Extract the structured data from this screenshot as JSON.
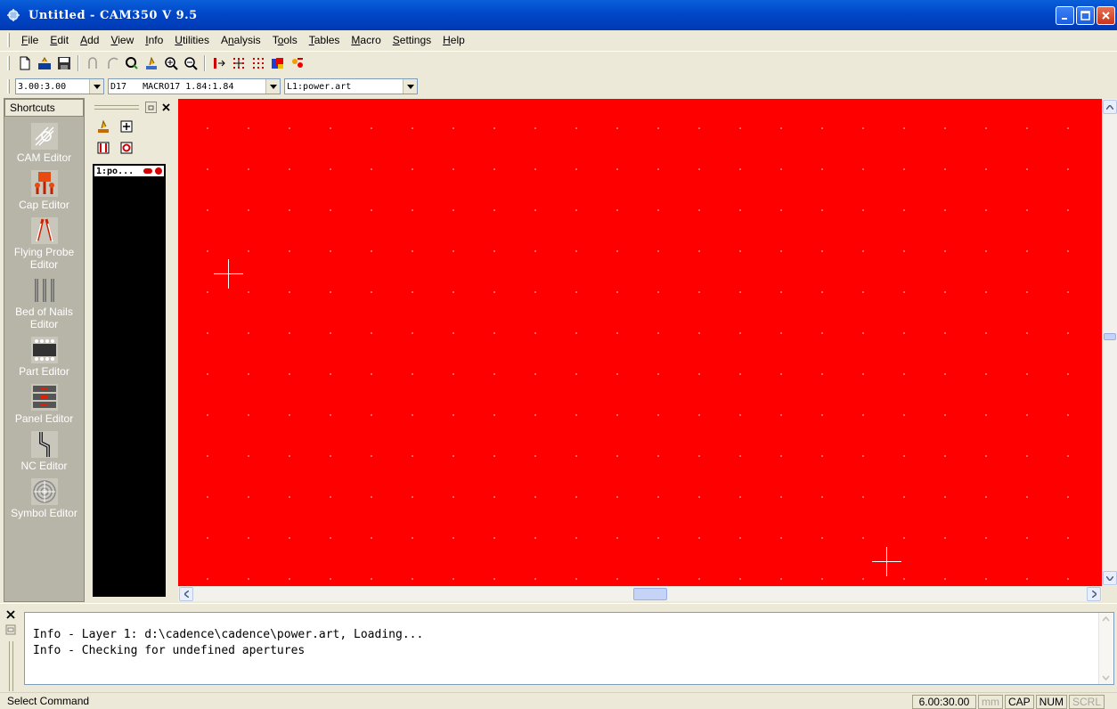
{
  "window": {
    "title": "Untitled - CAM350 V 9.5",
    "controls": {
      "minimize": "minimize",
      "maximize": "maximize",
      "close": "close"
    }
  },
  "menu": {
    "items": [
      {
        "label": "File",
        "accel": "F"
      },
      {
        "label": "Edit",
        "accel": "E"
      },
      {
        "label": "Add",
        "accel": "A"
      },
      {
        "label": "View",
        "accel": "V"
      },
      {
        "label": "Info",
        "accel": "I"
      },
      {
        "label": "Utilities",
        "accel": "U"
      },
      {
        "label": "Analysis",
        "accel": "n"
      },
      {
        "label": "Tools",
        "accel": "o"
      },
      {
        "label": "Tables",
        "accel": "T"
      },
      {
        "label": "Macro",
        "accel": "M"
      },
      {
        "label": "Settings",
        "accel": "S"
      },
      {
        "label": "Help",
        "accel": "H"
      }
    ]
  },
  "toolbar": {
    "icons": [
      "new-file-icon",
      "open-file-icon",
      "save-icon",
      "undo-icon",
      "redo-icon",
      "redraw-icon",
      "pan-icon",
      "zoom-in-icon",
      "zoom-out-icon",
      "snap-icon",
      "grid-icon",
      "dot-grid-icon",
      "color-icon",
      "highlight-icon"
    ]
  },
  "combos": {
    "grid": "3.00:3.00",
    "dcode": "D17   MACRO17 1.84:1.84",
    "layer": "L1:power.art"
  },
  "shortcuts": {
    "header": "Shortcuts",
    "items": [
      {
        "label": "CAM Editor",
        "icon": "cam-editor-icon"
      },
      {
        "label": "Cap Editor",
        "icon": "cap-editor-icon"
      },
      {
        "label": "Flying Probe Editor",
        "icon": "flying-probe-icon"
      },
      {
        "label": "Bed of Nails Editor",
        "icon": "bed-of-nails-icon"
      },
      {
        "label": "Part Editor",
        "icon": "part-editor-icon"
      },
      {
        "label": "Panel Editor",
        "icon": "panel-editor-icon"
      },
      {
        "label": "NC Editor",
        "icon": "nc-editor-icon"
      },
      {
        "label": "Symbol Editor",
        "icon": "symbol-editor-icon"
      }
    ]
  },
  "layers": {
    "items": [
      {
        "label": "1:po...",
        "color": "#D40000"
      }
    ]
  },
  "canvas": {
    "background": "#FF0000",
    "grid_dot_color": "#FFFFFF"
  },
  "output": {
    "lines": [
      "Info - Layer 1: d:\\cadence\\cadence\\power.art, Loading...",
      "Info - Checking for undefined apertures"
    ]
  },
  "status": {
    "text": "Select Command",
    "coords": "6.00:30.00",
    "unit": "mm",
    "cap": "CAP",
    "num": "NUM",
    "scrl": "SCRL"
  }
}
